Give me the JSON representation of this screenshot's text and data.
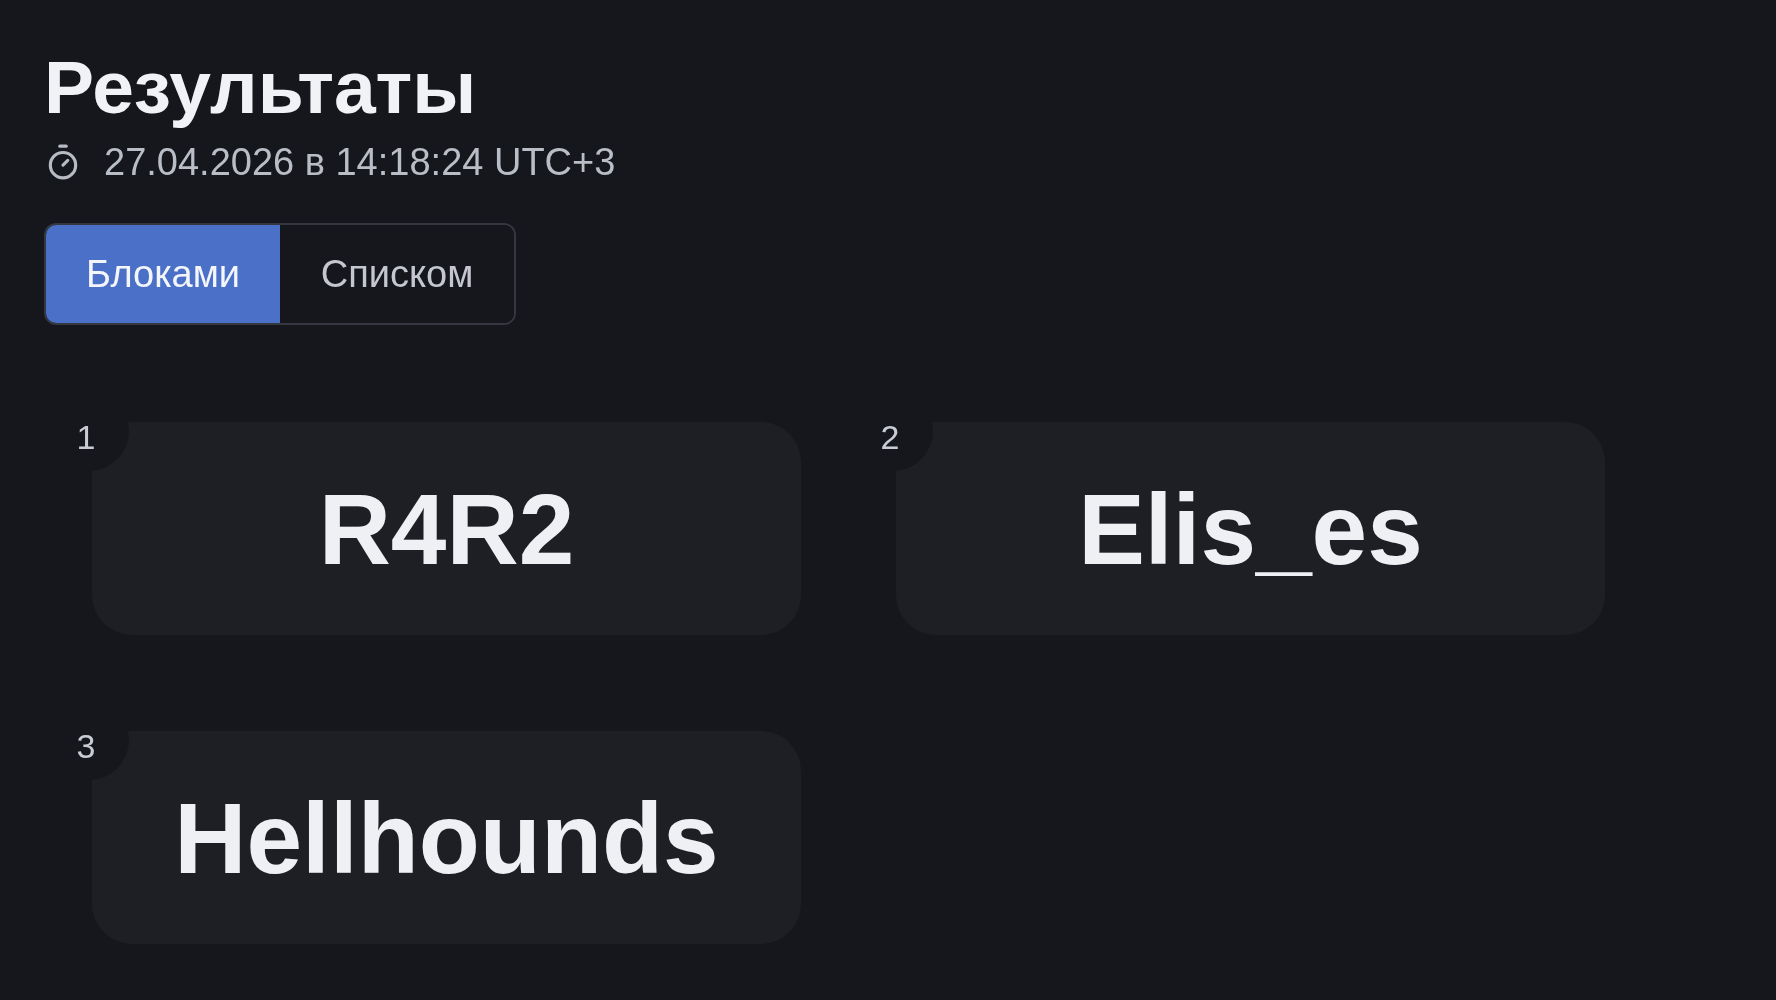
{
  "header": {
    "title": "Результаты",
    "timestamp": "27.04.2026 в 14:18:24 UTC+3"
  },
  "view_toggle": [
    {
      "label": "Блоками",
      "selected": true
    },
    {
      "label": "Списком",
      "selected": false
    }
  ],
  "results": [
    {
      "rank": "1",
      "name": "R4R2"
    },
    {
      "rank": "2",
      "name": "Elis_es"
    },
    {
      "rank": "3",
      "name": "Hellhounds"
    }
  ]
}
